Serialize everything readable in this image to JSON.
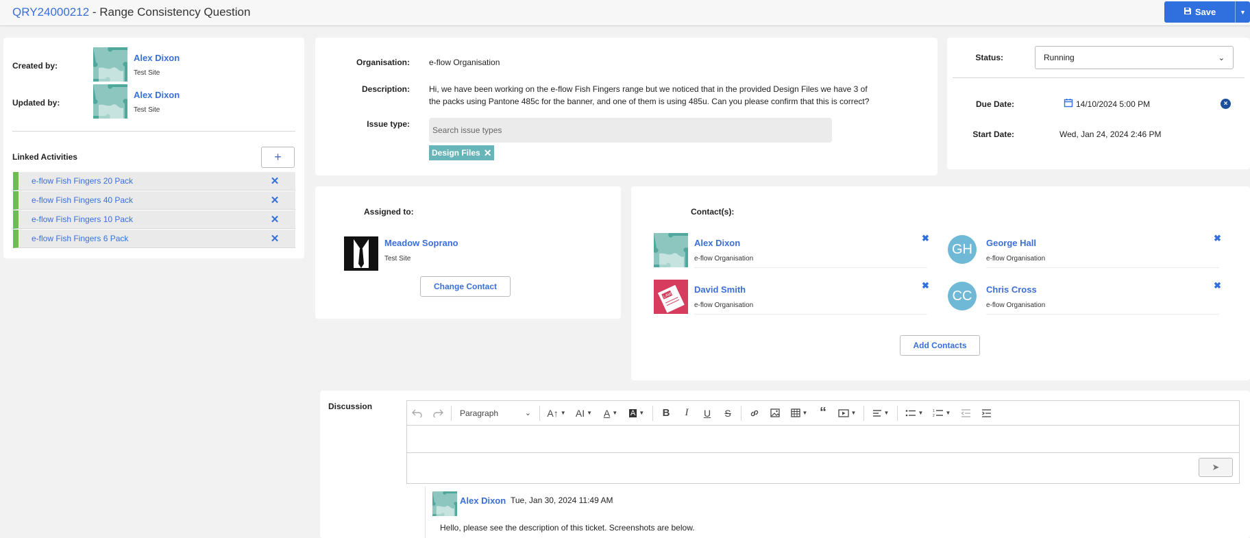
{
  "header": {
    "query_id": "QRY24000212",
    "title_separator": " - ",
    "title": "Range Consistency Question",
    "save_label": "Save"
  },
  "meta": {
    "created_label": "Created by:",
    "created_name": "Alex Dixon",
    "created_site": "Test Site",
    "updated_label": "Updated by:",
    "updated_name": "Alex Dixon",
    "updated_site": "Test Site"
  },
  "linked": {
    "title": "Linked Activities",
    "add_symbol": "+",
    "remove_symbol": "✕",
    "items": [
      {
        "label": "e-flow Fish Fingers 20 Pack"
      },
      {
        "label": "e-flow Fish Fingers 40 Pack"
      },
      {
        "label": "e-flow Fish Fingers 10 Pack"
      },
      {
        "label": "e-flow Fish Fingers 6 Pack"
      }
    ]
  },
  "details": {
    "organisation_label": "Organisation:",
    "organisation_value": "e-flow Organisation",
    "description_label": "Description:",
    "description_value": "Hi, we have been working on the e-flow Fish Fingers range but we noticed that in the provided Design Files we have 3 of the packs using Pantone 485c for the banner, and one of them is using 485u. Can you please confirm that this is correct?",
    "issue_label": "Issue type:",
    "issue_placeholder": "Search issue types",
    "issue_chip": "Design Files",
    "chip_remove": "✕"
  },
  "status": {
    "status_label": "Status:",
    "status_value": "Running",
    "due_label": "Due Date:",
    "due_value": "14/10/2024 5:00 PM",
    "start_label": "Start Date:",
    "start_value": "Wed, Jan 24, 2024 2:46 PM",
    "clear_symbol": "×"
  },
  "assigned": {
    "label": "Assigned to:",
    "name": "Meadow Soprano",
    "site": "Test Site",
    "change_label": "Change Contact"
  },
  "contacts": {
    "label": "Contact(s):",
    "remove_symbol": "✖",
    "add_label": "Add Contacts",
    "items": [
      {
        "name": "Alex Dixon",
        "org": "e-flow Organisation"
      },
      {
        "name": "George Hall",
        "org": "e-flow Organisation",
        "initials": "GH"
      },
      {
        "name": "David Smith",
        "org": "e-flow Organisation"
      },
      {
        "name": "Chris Cross",
        "org": "e-flow Organisation",
        "initials": "CC"
      }
    ]
  },
  "discussion": {
    "label": "Discussion",
    "paragraph_select": "Paragraph",
    "send_symbol": "➤",
    "comment": {
      "author": "Alex Dixon",
      "timestamp": "Tue, Jan 30, 2024 11:49 AM",
      "text": "Hello, please see the description of this ticket. Screenshots are below."
    }
  },
  "colors": {
    "accent": "#2f6fde",
    "link": "#3a6fd8",
    "activity_bar": "#6cbf4d",
    "chip": "#67b5b9",
    "avatar_teal": "#4fa89b",
    "initials_bg": "#6fb9d6",
    "law_avatar": "#d53c5e"
  }
}
